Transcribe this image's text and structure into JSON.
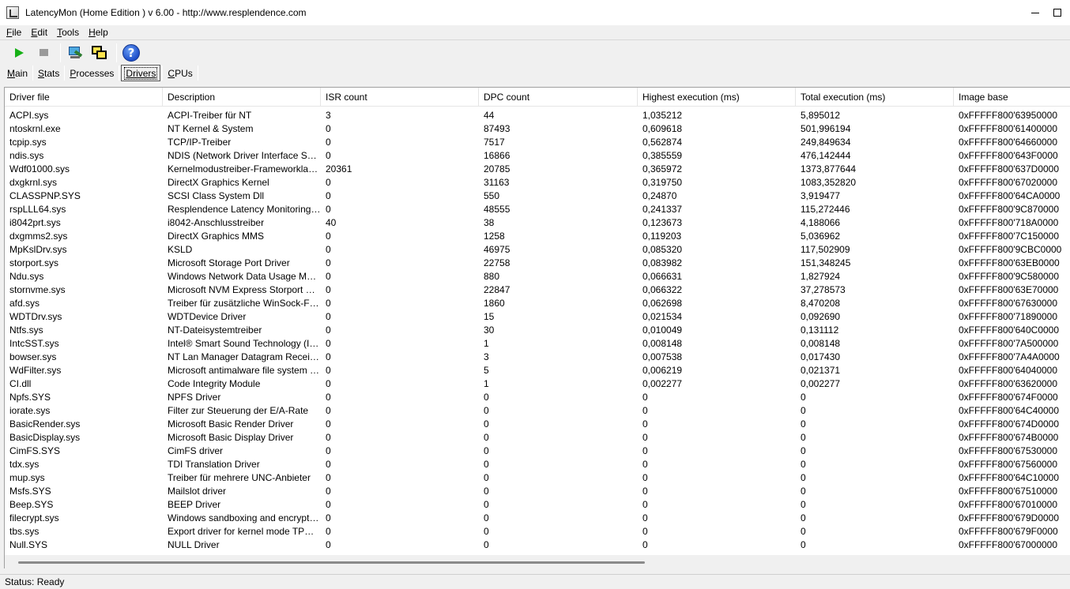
{
  "window": {
    "title": "LatencyMon  (Home Edition )  v 6.00 - http://www.resplendence.com"
  },
  "menu": [
    "File",
    "Edit",
    "Tools",
    "Help"
  ],
  "toolbar": {
    "icons": [
      "play-icon",
      "stop-icon",
      "monitor-icon",
      "windows-icon",
      "help-icon"
    ],
    "help_glyph": "?"
  },
  "tabs": [
    {
      "label": "Main",
      "active": false
    },
    {
      "label": "Stats",
      "active": false
    },
    {
      "label": "Processes",
      "active": false
    },
    {
      "label": "Drivers",
      "active": true
    },
    {
      "label": "CPUs",
      "active": false
    }
  ],
  "table": {
    "columns": [
      "Driver file",
      "Description",
      "ISR count",
      "DPC count",
      "Highest execution (ms)",
      "Total execution (ms)",
      "Image base"
    ],
    "rows": [
      [
        "ACPI.sys",
        "ACPI-Treiber für NT",
        "3",
        "44",
        "1,035212",
        "5,895012",
        "0xFFFFF800'63950000"
      ],
      [
        "ntoskrnl.exe",
        "NT Kernel & System",
        "0",
        "87493",
        "0,609618",
        "501,996194",
        "0xFFFFF800'61400000"
      ],
      [
        "tcpip.sys",
        "TCP/IP-Treiber",
        "0",
        "7517",
        "0,562874",
        "249,849634",
        "0xFFFFF800'64660000"
      ],
      [
        "ndis.sys",
        "NDIS (Network Driver Interface Spe...",
        "0",
        "16866",
        "0,385559",
        "476,142444",
        "0xFFFFF800'643F0000"
      ],
      [
        "Wdf01000.sys",
        "Kernelmodustreiber-Frameworklaufzeit",
        "20361",
        "20785",
        "0,365972",
        "1373,877644",
        "0xFFFFF800'637D0000"
      ],
      [
        "dxgkrnl.sys",
        "DirectX Graphics Kernel",
        "0",
        "31163",
        "0,319750",
        "1083,352820",
        "0xFFFFF800'67020000"
      ],
      [
        "CLASSPNP.SYS",
        "SCSI Class System Dll",
        "0",
        "550",
        "0,24870",
        "3,919477",
        "0xFFFFF800'64CA0000"
      ],
      [
        "rspLLL64.sys",
        "Resplendence Latency Monitoring a...",
        "0",
        "48555",
        "0,241337",
        "115,272446",
        "0xFFFFF800'9C870000"
      ],
      [
        "i8042prt.sys",
        "i8042-Anschlusstreiber",
        "40",
        "38",
        "0,123673",
        "4,188066",
        "0xFFFFF800'718A0000"
      ],
      [
        "dxgmms2.sys",
        "DirectX Graphics MMS",
        "0",
        "1258",
        "0,119203",
        "5,036962",
        "0xFFFFF800'7C150000"
      ],
      [
        "MpKslDrv.sys",
        "KSLD",
        "0",
        "46975",
        "0,085320",
        "117,502909",
        "0xFFFFF800'9CBC0000"
      ],
      [
        "storport.sys",
        "Microsoft Storage Port Driver",
        "0",
        "22758",
        "0,083982",
        "151,348245",
        "0xFFFFF800'63EB0000"
      ],
      [
        "Ndu.sys",
        "Windows Network Data Usage Monit...",
        "0",
        "880",
        "0,066631",
        "1,827924",
        "0xFFFFF800'9C580000"
      ],
      [
        "stornvme.sys",
        "Microsoft NVM Express Storport Mini...",
        "0",
        "22847",
        "0,066322",
        "37,278573",
        "0xFFFFF800'63E70000"
      ],
      [
        "afd.sys",
        "Treiber für zusätzliche WinSock-Fun...",
        "0",
        "1860",
        "0,062698",
        "8,470208",
        "0xFFFFF800'67630000"
      ],
      [
        "WDTDrv.sys",
        "WDTDevice Driver",
        "0",
        "15",
        "0,021534",
        "0,092690",
        "0xFFFFF800'71890000"
      ],
      [
        "Ntfs.sys",
        "NT-Dateisystemtreiber",
        "0",
        "30",
        "0,010049",
        "0,131112",
        "0xFFFFF800'640C0000"
      ],
      [
        "IntcSST.sys",
        "Intel® Smart Sound Technology (In...",
        "0",
        "1",
        "0,008148",
        "0,008148",
        "0xFFFFF800'7A500000"
      ],
      [
        "bowser.sys",
        "NT Lan Manager Datagram Receiver...",
        "0",
        "3",
        "0,007538",
        "0,017430",
        "0xFFFFF800'7A4A0000"
      ],
      [
        "WdFilter.sys",
        "Microsoft antimalware file system filt...",
        "0",
        "5",
        "0,006219",
        "0,021371",
        "0xFFFFF800'64040000"
      ],
      [
        "CI.dll",
        "Code Integrity Module",
        "0",
        "1",
        "0,002277",
        "0,002277",
        "0xFFFFF800'63620000"
      ],
      [
        "Npfs.SYS",
        "NPFS Driver",
        "0",
        "0",
        "0",
        "0",
        "0xFFFFF800'674F0000"
      ],
      [
        "iorate.sys",
        "Filter zur Steuerung der E/A-Rate",
        "0",
        "0",
        "0",
        "0",
        "0xFFFFF800'64C40000"
      ],
      [
        "BasicRender.sys",
        "Microsoft Basic Render Driver",
        "0",
        "0",
        "0",
        "0",
        "0xFFFFF800'674D0000"
      ],
      [
        "BasicDisplay.sys",
        "Microsoft Basic Display Driver",
        "0",
        "0",
        "0",
        "0",
        "0xFFFFF800'674B0000"
      ],
      [
        "CimFS.SYS",
        "CimFS driver",
        "0",
        "0",
        "0",
        "0",
        "0xFFFFF800'67530000"
      ],
      [
        "tdx.sys",
        "TDI Translation Driver",
        "0",
        "0",
        "0",
        "0",
        "0xFFFFF800'67560000"
      ],
      [
        "mup.sys",
        "Treiber für mehrere UNC-Anbieter",
        "0",
        "0",
        "0",
        "0",
        "0xFFFFF800'64C10000"
      ],
      [
        "Msfs.SYS",
        "Mailslot driver",
        "0",
        "0",
        "0",
        "0",
        "0xFFFFF800'67510000"
      ],
      [
        "Beep.SYS",
        "BEEP Driver",
        "0",
        "0",
        "0",
        "0",
        "0xFFFFF800'67010000"
      ],
      [
        "filecrypt.sys",
        "Windows sandboxing and encryptio...",
        "0",
        "0",
        "0",
        "0",
        "0xFFFFF800'679D0000"
      ],
      [
        "tbs.sys",
        "Export driver for kernel mode TPM API",
        "0",
        "0",
        "0",
        "0",
        "0xFFFFF800'679F0000"
      ],
      [
        "Null.SYS",
        "NULL Driver",
        "0",
        "0",
        "0",
        "0",
        "0xFFFFF800'67000000"
      ]
    ]
  },
  "status": "Status: Ready"
}
